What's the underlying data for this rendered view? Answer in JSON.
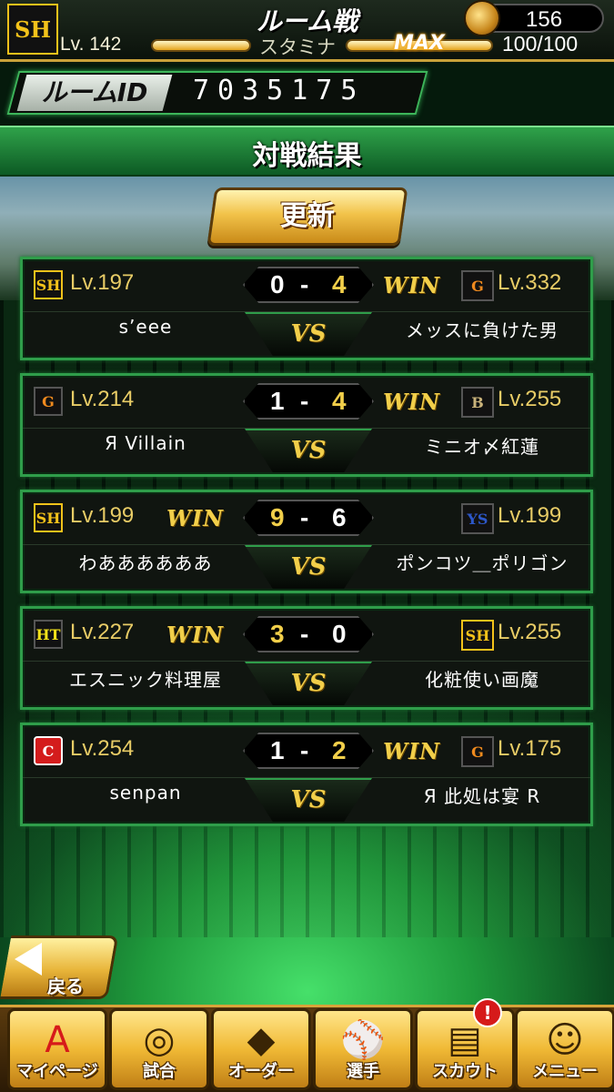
{
  "header": {
    "team_logo": "SH",
    "title": "ルーム戦",
    "level": "Lv. 142",
    "stamina_label": "スタミナ",
    "stamina_max": "MAX",
    "stamina_value": "100/100",
    "stamina_fraction": 1.0,
    "coins": "156",
    "coin_icon": "baseball-fire-coin-icon"
  },
  "room": {
    "label": "ルームID",
    "id": "7035175"
  },
  "results": {
    "title": "対戦結果",
    "update_label": "更新",
    "matches": [
      {
        "left_logo": "SH",
        "left_level": "Lv.197",
        "left_name": "s’eee",
        "left_score": "0",
        "right_score": "4",
        "right_logo": "G",
        "right_level": "Lv.332",
        "right_name": "メッスに負けた男",
        "winner": "right",
        "win_label": "WIN",
        "vs_label": "VS"
      },
      {
        "left_logo": "G",
        "left_level": "Lv.214",
        "left_name": "Я Villain",
        "left_score": "1",
        "right_score": "4",
        "right_logo": "B",
        "right_level": "Lv.255",
        "right_name": "ミニオ〆紅蓮",
        "winner": "right",
        "win_label": "WIN",
        "vs_label": "VS"
      },
      {
        "left_logo": "SH",
        "left_level": "Lv.199",
        "left_name": "わああああああ",
        "left_score": "9",
        "right_score": "6",
        "right_logo": "YS",
        "right_level": "Lv.199",
        "right_name": "ポンコツ＿ポリゴン",
        "winner": "left",
        "win_label": "WIN",
        "vs_label": "VS"
      },
      {
        "left_logo": "HT",
        "left_level": "Lv.227",
        "left_name": "エスニック料理屋",
        "left_score": "3",
        "right_score": "0",
        "right_logo": "SH",
        "right_level": "Lv.255",
        "right_name": "化粧使い画魔",
        "winner": "left",
        "win_label": "WIN",
        "vs_label": "VS"
      },
      {
        "left_logo": "C",
        "left_level": "Lv.254",
        "left_name": "senpan",
        "left_score": "1",
        "right_score": "2",
        "right_logo": "G",
        "right_level": "Lv.175",
        "right_name": "Я 此処は宴 R",
        "winner": "right",
        "win_label": "WIN",
        "vs_label": "VS"
      }
    ]
  },
  "back": {
    "label": "戻る",
    "icon": "left-arrow-icon"
  },
  "nav": {
    "items": [
      {
        "label": "マイページ",
        "icon": "letter-a-icon"
      },
      {
        "label": "試合",
        "icon": "stadium-icon"
      },
      {
        "label": "オーダー",
        "icon": "field-players-icon"
      },
      {
        "label": "選手",
        "icon": "player-icon"
      },
      {
        "label": "スカウト",
        "icon": "scout-card-icon"
      },
      {
        "label": "メニュー",
        "icon": "menu-character-icon"
      }
    ],
    "badge": "!"
  },
  "colors": {
    "accent_green": "#2f9d4a",
    "gold": "#f2cf4a",
    "score_winner": "#f2cf4a"
  }
}
